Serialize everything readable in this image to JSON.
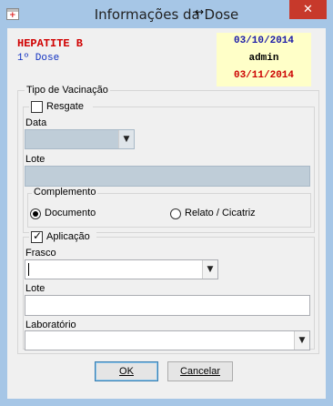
{
  "window": {
    "title": "Informações da Dose",
    "close_label": "✕"
  },
  "header": {
    "vaccine_name": "HEPATITE B",
    "dose": "1º Dose",
    "date_top": "03/10/2014",
    "user": "admin",
    "date_bottom": "03/11/2014"
  },
  "form": {
    "group_title": "Tipo de Vacinação",
    "resgate": {
      "label": "Resgate",
      "checked": false,
      "data_label": "Data",
      "data_value": "",
      "lote_label": "Lote",
      "lote_value": ""
    },
    "complemento": {
      "title": "Complemento",
      "options": [
        {
          "label": "Documento",
          "selected": true
        },
        {
          "label": "Relato / Cicatriz",
          "selected": false
        }
      ]
    },
    "aplicacao": {
      "label": "Aplicação",
      "checked": true,
      "frasco_label": "Frasco",
      "frasco_value": "",
      "lote_label": "Lote",
      "lote_value": "",
      "laboratorio_label": "Laboratório",
      "laboratorio_value": ""
    }
  },
  "buttons": {
    "ok_label": "OK",
    "cancel_label": "Cancelar"
  },
  "icons": {
    "app": "vaccine-card-icon",
    "close": "close-icon",
    "dropdown": "chevron-down-icon",
    "check": "checkmark-icon",
    "cursor": "resize-cursor-icon"
  },
  "colors": {
    "title_bar": "#a6c6e6",
    "close_button": "#c7392b",
    "vaccine_name": "#d00000",
    "dose": "#1030c0",
    "info_box": "#ffffc8",
    "date_top": "#1a1aa8",
    "date_bottom": "#cc0000",
    "disabled_field": "#bfcdd8"
  }
}
